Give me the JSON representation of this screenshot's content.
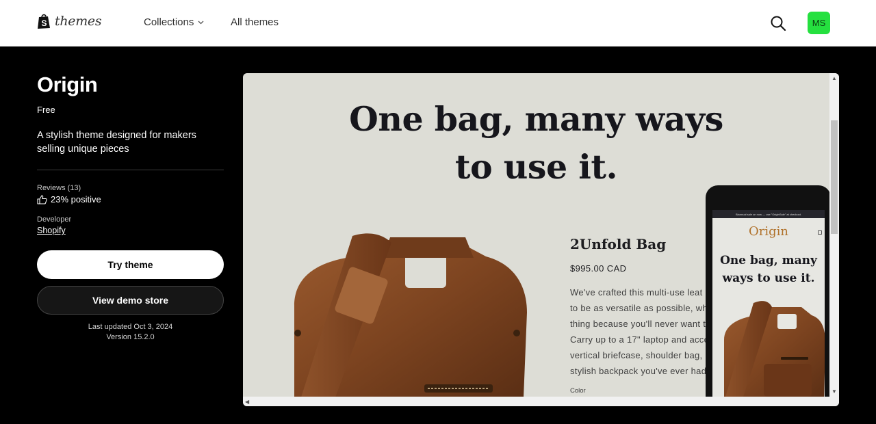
{
  "header": {
    "logo_text": "themes",
    "nav": {
      "collections": "Collections",
      "all_themes": "All themes"
    },
    "avatar_initials": "MS",
    "avatar_color": "#25e03f"
  },
  "theme": {
    "name": "Origin",
    "price": "Free",
    "description": "A stylish theme designed for makers selling unique pieces",
    "reviews_label": "Reviews (13)",
    "rating": "23% positive",
    "developer_label": "Developer",
    "developer": "Shopify",
    "try_button": "Try theme",
    "demo_button": "View demo store",
    "last_updated": "Last updated Oct 3, 2024",
    "version": "Version 15.2.0"
  },
  "preview": {
    "headline_line1": "One bag, many ways",
    "headline_line2": "to use it.",
    "product_name": "2Unfold Bag",
    "product_price": "$995.00 CAD",
    "product_desc": [
      "We've crafted this multi-use leat",
      "to be as versatile as possible, wh",
      "thing because you'll never want t",
      "Carry up to a 17\" laptop and acce",
      "vertical briefcase, shoulder bag,",
      "stylish backpack you've ever had"
    ],
    "color_label": "Color",
    "mobile": {
      "announcement": "Biannual sale on now — use \"OriginSale\" at checkout.",
      "logo": "Origin",
      "headline_line1": "One bag, many",
      "headline_line2": "ways to use it."
    }
  }
}
